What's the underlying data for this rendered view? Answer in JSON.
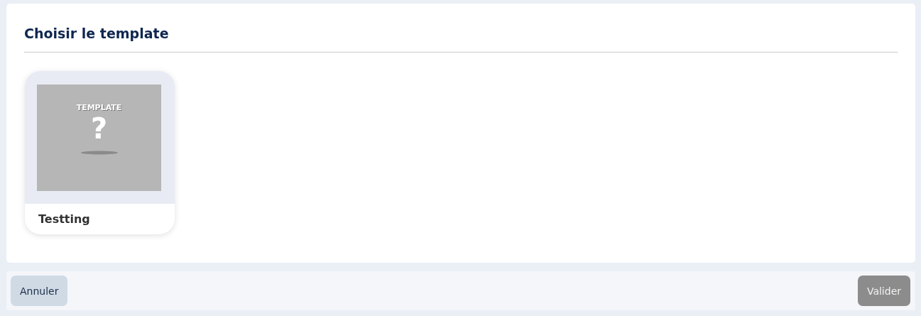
{
  "title": "Choisir le template",
  "templates": [
    {
      "name": "Testting",
      "thumbnail": {
        "caption": "TEMPLATE",
        "symbol": "?"
      },
      "selected": false
    }
  ],
  "buttons": [
    {
      "label": "Annuler",
      "kind": "cancel",
      "disabled": false
    },
    {
      "label": "Valider",
      "kind": "confirm",
      "disabled": true
    }
  ]
}
